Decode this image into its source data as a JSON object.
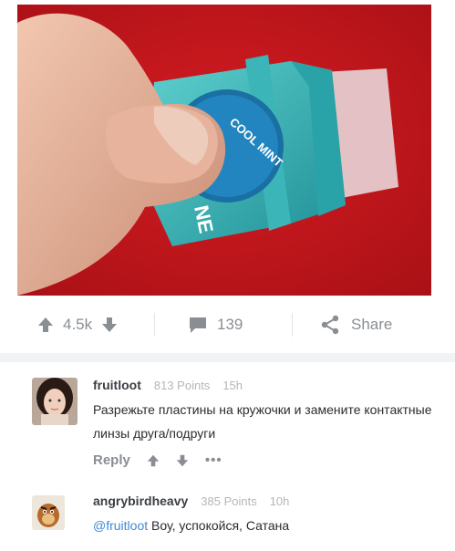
{
  "post": {
    "upvotes": "4.5k",
    "comments_count": "139",
    "share_label": "Share",
    "photo_label": "COOL MINT",
    "photo_brand": "NE"
  },
  "comments": [
    {
      "username": "fruitloot",
      "points": "813 Points",
      "time": "15h",
      "text": "Разрежьте пластины на кружочки и замените контактные линзы друга/подруги",
      "reply_label": "Reply",
      "more_label": "•••"
    },
    {
      "username": "angrybirdheavy",
      "points": "385 Points",
      "time": "10h",
      "mention": "@fruitloot",
      "text": "Воу, успокойся, Сатана"
    }
  ],
  "colors": {
    "photo_bg": "#c8161c",
    "mention": "#3f89d8",
    "muted": "#8a8e94"
  },
  "icons": [
    "upvote-icon",
    "downvote-icon",
    "comment-icon",
    "share-icon"
  ]
}
